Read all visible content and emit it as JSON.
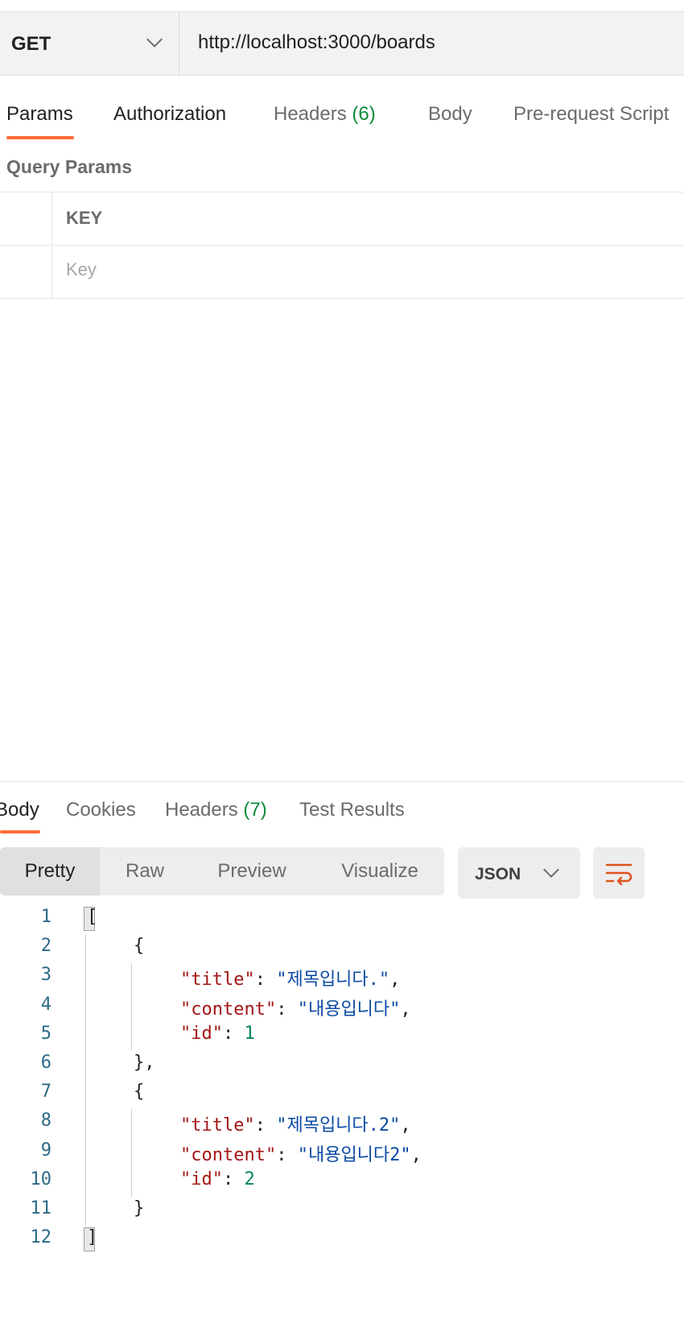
{
  "request": {
    "method": "GET",
    "url": "http://localhost:3000/boards"
  },
  "request_tabs": [
    {
      "label": "Params",
      "count": ""
    },
    {
      "label": "Authorization",
      "count": ""
    },
    {
      "label": "Headers",
      "count": "(6)"
    },
    {
      "label": "Body",
      "count": ""
    },
    {
      "label": "Pre-request Script",
      "count": ""
    }
  ],
  "active_request_tab": "Params",
  "query_params": {
    "title": "Query Params",
    "column_key": "KEY",
    "key_placeholder": "Key"
  },
  "response_tabs": [
    {
      "label": "Body",
      "count": ""
    },
    {
      "label": "Cookies",
      "count": ""
    },
    {
      "label": "Headers",
      "count": "(7)"
    },
    {
      "label": "Test Results",
      "count": ""
    }
  ],
  "active_response_tab": "Body",
  "view_modes": [
    "Pretty",
    "Raw",
    "Preview",
    "Visualize"
  ],
  "active_view_mode": "Pretty",
  "format": "JSON",
  "line_numbers": [
    "1",
    "2",
    "3",
    "4",
    "5",
    "6",
    "7",
    "8",
    "9",
    "10",
    "11",
    "12"
  ],
  "code_lines": [
    {
      "indent": 0,
      "tokens": [
        {
          "t": "p",
          "v": "["
        }
      ]
    },
    {
      "indent": 1,
      "tokens": [
        {
          "t": "p",
          "v": "{"
        }
      ]
    },
    {
      "indent": 2,
      "tokens": [
        {
          "t": "k",
          "v": "\"title\""
        },
        {
          "t": "p",
          "v": ": "
        },
        {
          "t": "s",
          "v": "\"제목입니다.\""
        },
        {
          "t": "p",
          "v": ","
        }
      ]
    },
    {
      "indent": 2,
      "tokens": [
        {
          "t": "k",
          "v": "\"content\""
        },
        {
          "t": "p",
          "v": ": "
        },
        {
          "t": "s",
          "v": "\"내용입니다\""
        },
        {
          "t": "p",
          "v": ","
        }
      ]
    },
    {
      "indent": 2,
      "tokens": [
        {
          "t": "k",
          "v": "\"id\""
        },
        {
          "t": "p",
          "v": ": "
        },
        {
          "t": "n",
          "v": "1"
        }
      ]
    },
    {
      "indent": 1,
      "tokens": [
        {
          "t": "p",
          "v": "},"
        }
      ]
    },
    {
      "indent": 1,
      "tokens": [
        {
          "t": "p",
          "v": "{"
        }
      ]
    },
    {
      "indent": 2,
      "tokens": [
        {
          "t": "k",
          "v": "\"title\""
        },
        {
          "t": "p",
          "v": ": "
        },
        {
          "t": "s",
          "v": "\"제목입니다.2\""
        },
        {
          "t": "p",
          "v": ","
        }
      ]
    },
    {
      "indent": 2,
      "tokens": [
        {
          "t": "k",
          "v": "\"content\""
        },
        {
          "t": "p",
          "v": ": "
        },
        {
          "t": "s",
          "v": "\"내용입니다2\""
        },
        {
          "t": "p",
          "v": ","
        }
      ]
    },
    {
      "indent": 2,
      "tokens": [
        {
          "t": "k",
          "v": "\"id\""
        },
        {
          "t": "p",
          "v": ": "
        },
        {
          "t": "n",
          "v": "2"
        }
      ]
    },
    {
      "indent": 1,
      "tokens": [
        {
          "t": "p",
          "v": "}"
        }
      ]
    },
    {
      "indent": 0,
      "tokens": [
        {
          "t": "p",
          "v": "]"
        }
      ]
    }
  ],
  "colors": {
    "accent": "#ff6c37",
    "count_green": "#0f8a3b",
    "json_key": "#a31515",
    "json_string": "#0a4aa3",
    "json_number": "#098658"
  },
  "icons": {
    "method_dropdown": "chevron-down-icon",
    "format_dropdown": "chevron-down-icon",
    "wrap": "wrap-lines-icon"
  }
}
